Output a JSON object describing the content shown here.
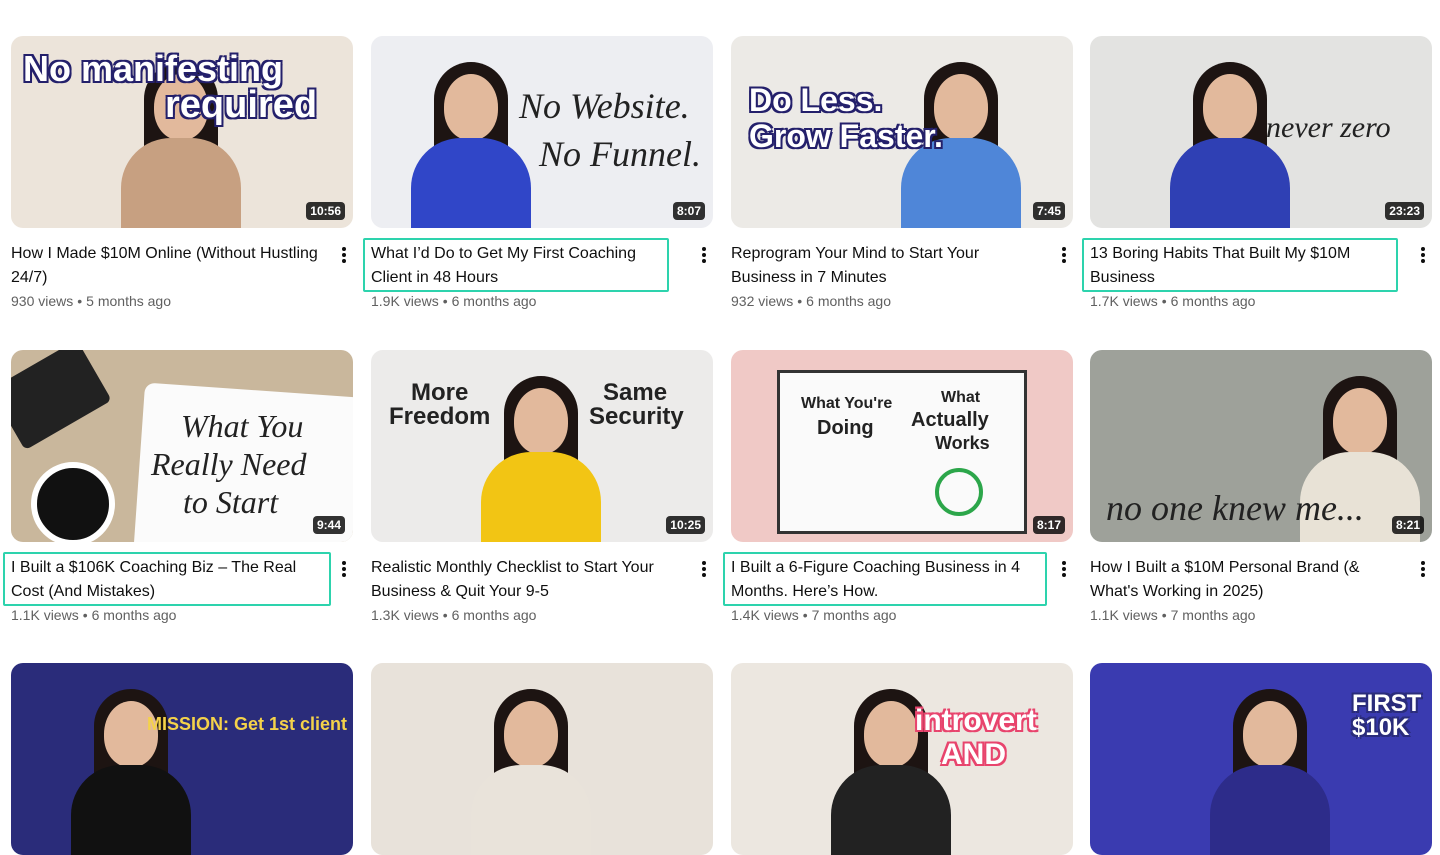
{
  "videos": [
    {
      "title": "How I Made $10M Online (Without Hustling 24/7)",
      "views": "930 views",
      "age": "5 months ago",
      "duration": "10:56",
      "overlay": "No manifesting required",
      "bg": "#ece4da"
    },
    {
      "title": "What I’d Do to Get My First Coaching Client in 48 Hours",
      "views": "1.9K views",
      "age": "6 months ago",
      "duration": "8:07",
      "overlay": "No Website. No Funnel.",
      "bg": "#edeef2"
    },
    {
      "title": "Reprogram Your Mind to Start Your Business in 7 Minutes",
      "views": "932 views",
      "age": "6 months ago",
      "duration": "7:45",
      "overlay": "Do Less. Grow Faster.",
      "bg": "#eceae6"
    },
    {
      "title": "13 Boring Habits That Built My $10M Business",
      "views": "1.7K views",
      "age": "6 months ago",
      "duration": "23:23",
      "overlay": "never zero",
      "bg": "#e3e3e1"
    },
    {
      "title": "I Built a $106K Coaching Biz – The Real Cost (And Mistakes)",
      "views": "1.1K views",
      "age": "6 months ago",
      "duration": "9:44",
      "overlay": "What You Really Need to Start",
      "bg": "#c9b79c"
    },
    {
      "title": "Realistic Monthly Checklist to Start Your Business & Quit Your 9-5",
      "views": "1.3K views",
      "age": "6 months ago",
      "duration": "10:25",
      "overlay": "More Freedom | Same Security",
      "bg": "#ecebea"
    },
    {
      "title": "I Built a 6-Figure Coaching Business in 4 Months. Here’s How.",
      "views": "1.4K views",
      "age": "7 months ago",
      "duration": "8:17",
      "overlay": "What You're Doing | What Actually Works",
      "bg": "#f0c9c6"
    },
    {
      "title": "How I Built a $10M Personal Brand (& What's Working in 2025)",
      "views": "1.1K views",
      "age": "7 months ago",
      "duration": "8:21",
      "overlay": "no one knew me...",
      "bg": "#9ea19a"
    },
    {
      "overlay": "MISSION: Get 1st client",
      "bg": "#2a2c7a"
    },
    {
      "overlay": "",
      "bg": "#e8e2da"
    },
    {
      "overlay": "introvert AND",
      "bg": "#ece7e0"
    },
    {
      "overlay": "FIRST $10K",
      "bg": "#3a3bb0"
    }
  ],
  "separator": "•",
  "highlighted": [
    1,
    3,
    4,
    6
  ],
  "colors": {
    "highlight": "#2dd3ad",
    "text": "#0f0f0f",
    "meta": "#606060"
  },
  "icons": {
    "more": "more-vert-icon"
  }
}
